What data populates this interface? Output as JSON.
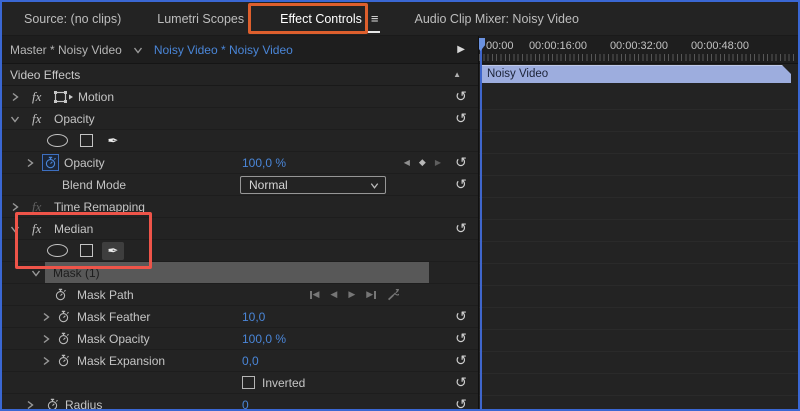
{
  "colors": {
    "focus_border": "#3a67d3",
    "accent_blue": "#4a86d8",
    "annotation_orange": "#dd5f2d",
    "annotation_red": "#ee5449",
    "clip_bar": "#9dadde",
    "mask_selected_bg": "#585858"
  },
  "icons": {
    "menu": "≡",
    "reset": "↺",
    "pen": "✒",
    "collapse_up": "▲",
    "play": "▶",
    "kf_previous": "◀",
    "kf_next": "▶",
    "kf_add_diamond": "◆"
  },
  "tabbar": {
    "tabs": [
      {
        "label": "Source: (no clips)",
        "active": false
      },
      {
        "label": "Lumetri Scopes",
        "active": false
      },
      {
        "label": "Effect Controls",
        "active": true
      },
      {
        "label": "Audio Clip Mixer: Noisy Video",
        "active": false
      }
    ]
  },
  "clip_header": {
    "master_label": "Master * Noisy Video",
    "clip_label": "Noisy Video * Noisy Video"
  },
  "effects_panel": {
    "header": "Video Effects",
    "fx_badge": "fx",
    "motion": {
      "label": "Motion"
    },
    "opacity": {
      "label": "Opacity",
      "property_label": "Opacity",
      "property_value": "100,0 %",
      "blend_mode_label": "Blend Mode",
      "blend_mode_value": "Normal"
    },
    "time_remapping": {
      "label": "Time Remapping"
    },
    "median": {
      "label": "Median"
    },
    "mask": {
      "label": "Mask (1)",
      "path_label": "Mask Path",
      "feather_label": "Mask Feather",
      "feather_value": "10,0",
      "opacity_label": "Mask Opacity",
      "opacity_value": "100,0 %",
      "expansion_label": "Mask Expansion",
      "expansion_value": "0,0",
      "inverted_label": "Inverted"
    },
    "radius": {
      "label": "Radius",
      "value": "0"
    }
  },
  "timeline": {
    "ruler_labels": [
      "00:00",
      "00:00:16:00",
      "00:00:32:00",
      "00:00:48:00"
    ],
    "clip_name": "Noisy Video"
  }
}
